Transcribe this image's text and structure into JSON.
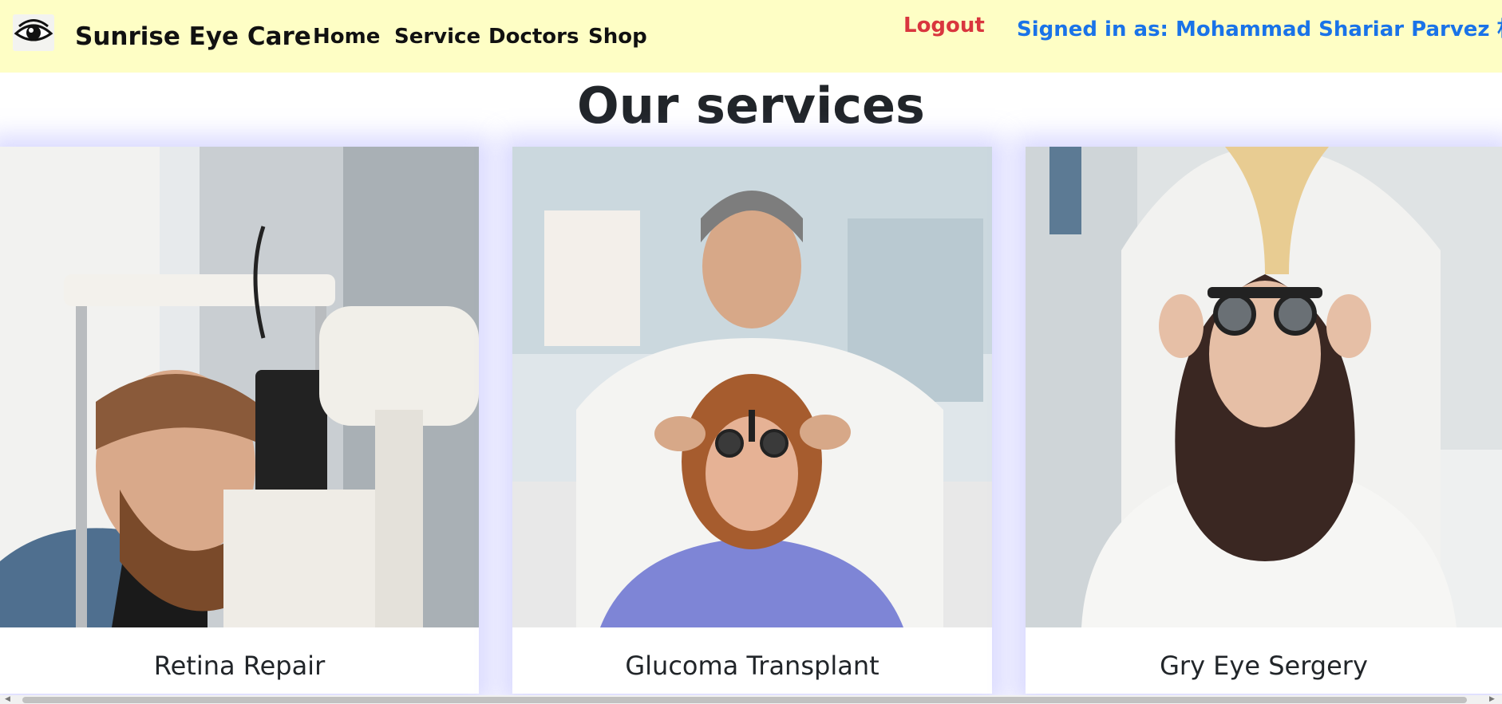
{
  "navbar": {
    "brand_name": "Sunrise Eye Care",
    "logo_icon": "eye-icon",
    "links": [
      "Home",
      "Service",
      "Doctors",
      "Shop"
    ],
    "logout_label": "Logout",
    "signed_in_text": "Signed in as: Mohammad Shariar Parvez 朴维",
    "colors": {
      "background": "#fefec5",
      "logout": "#d9363e",
      "signed_in": "#1a73e8"
    }
  },
  "main": {
    "heading": "Our services",
    "cards": [
      {
        "title": "Retina Repair",
        "image": "man-at-slit-lamp-photo"
      },
      {
        "title": "Glucoma Transplant",
        "image": "doctor-fitting-trial-frame-photo"
      },
      {
        "title": "Gry Eye Sergery",
        "image": "woman-trial-lens-photo"
      }
    ],
    "colors": {
      "card_glow": "#9696ff"
    }
  }
}
